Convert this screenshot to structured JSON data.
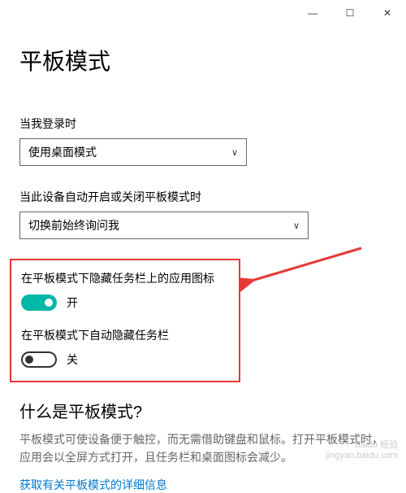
{
  "titlebar": {
    "minimize": "—",
    "maximize": "☐",
    "close": "✕"
  },
  "page_title": "平板模式",
  "login_section": {
    "label": "当我登录时",
    "value": "使用桌面模式"
  },
  "auto_switch_section": {
    "label": "当此设备自动开启或关闭平板模式时",
    "value": "切换前始终询问我"
  },
  "toggles": {
    "hide_app_icons": {
      "label": "在平板模式下隐藏任务栏上的应用图标",
      "state": "开"
    },
    "auto_hide_taskbar": {
      "label": "在平板模式下自动隐藏任务栏",
      "state": "关"
    }
  },
  "info_section": {
    "heading": "什么是平板模式?",
    "description": "平板模式可使设备便于触控，而无需借助键盘和鼠标。打开平板模式时，应用会以全屏方式打开，且任务栏和桌面图标会减少。",
    "link": "获取有关平板模式的详细信息"
  },
  "watermark": {
    "line1": "Baidu 经验",
    "line2": "jingyan.baidu.com"
  }
}
